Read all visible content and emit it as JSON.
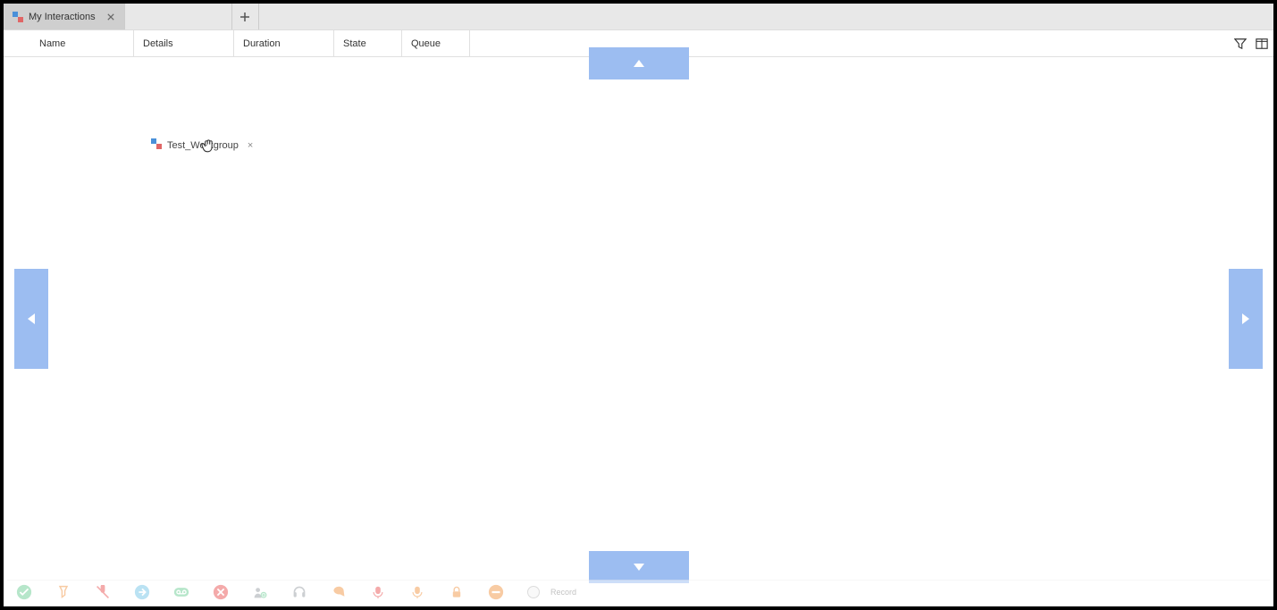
{
  "tabs": {
    "active": {
      "label": "My Interactions"
    }
  },
  "columns": {
    "name": "Name",
    "details": "Details",
    "duration": "Duration",
    "state": "State",
    "queue": "Queue"
  },
  "floatingTab": {
    "label": "Test_Workgroup"
  },
  "toolbar": {
    "record": "Record"
  },
  "colors": {
    "pager": "#9cbdf1",
    "ok": "#6fcf97",
    "warn": "#f2994a",
    "danger": "#eb5757",
    "info": "#56ccf2",
    "muted": "#bdbdbd"
  }
}
